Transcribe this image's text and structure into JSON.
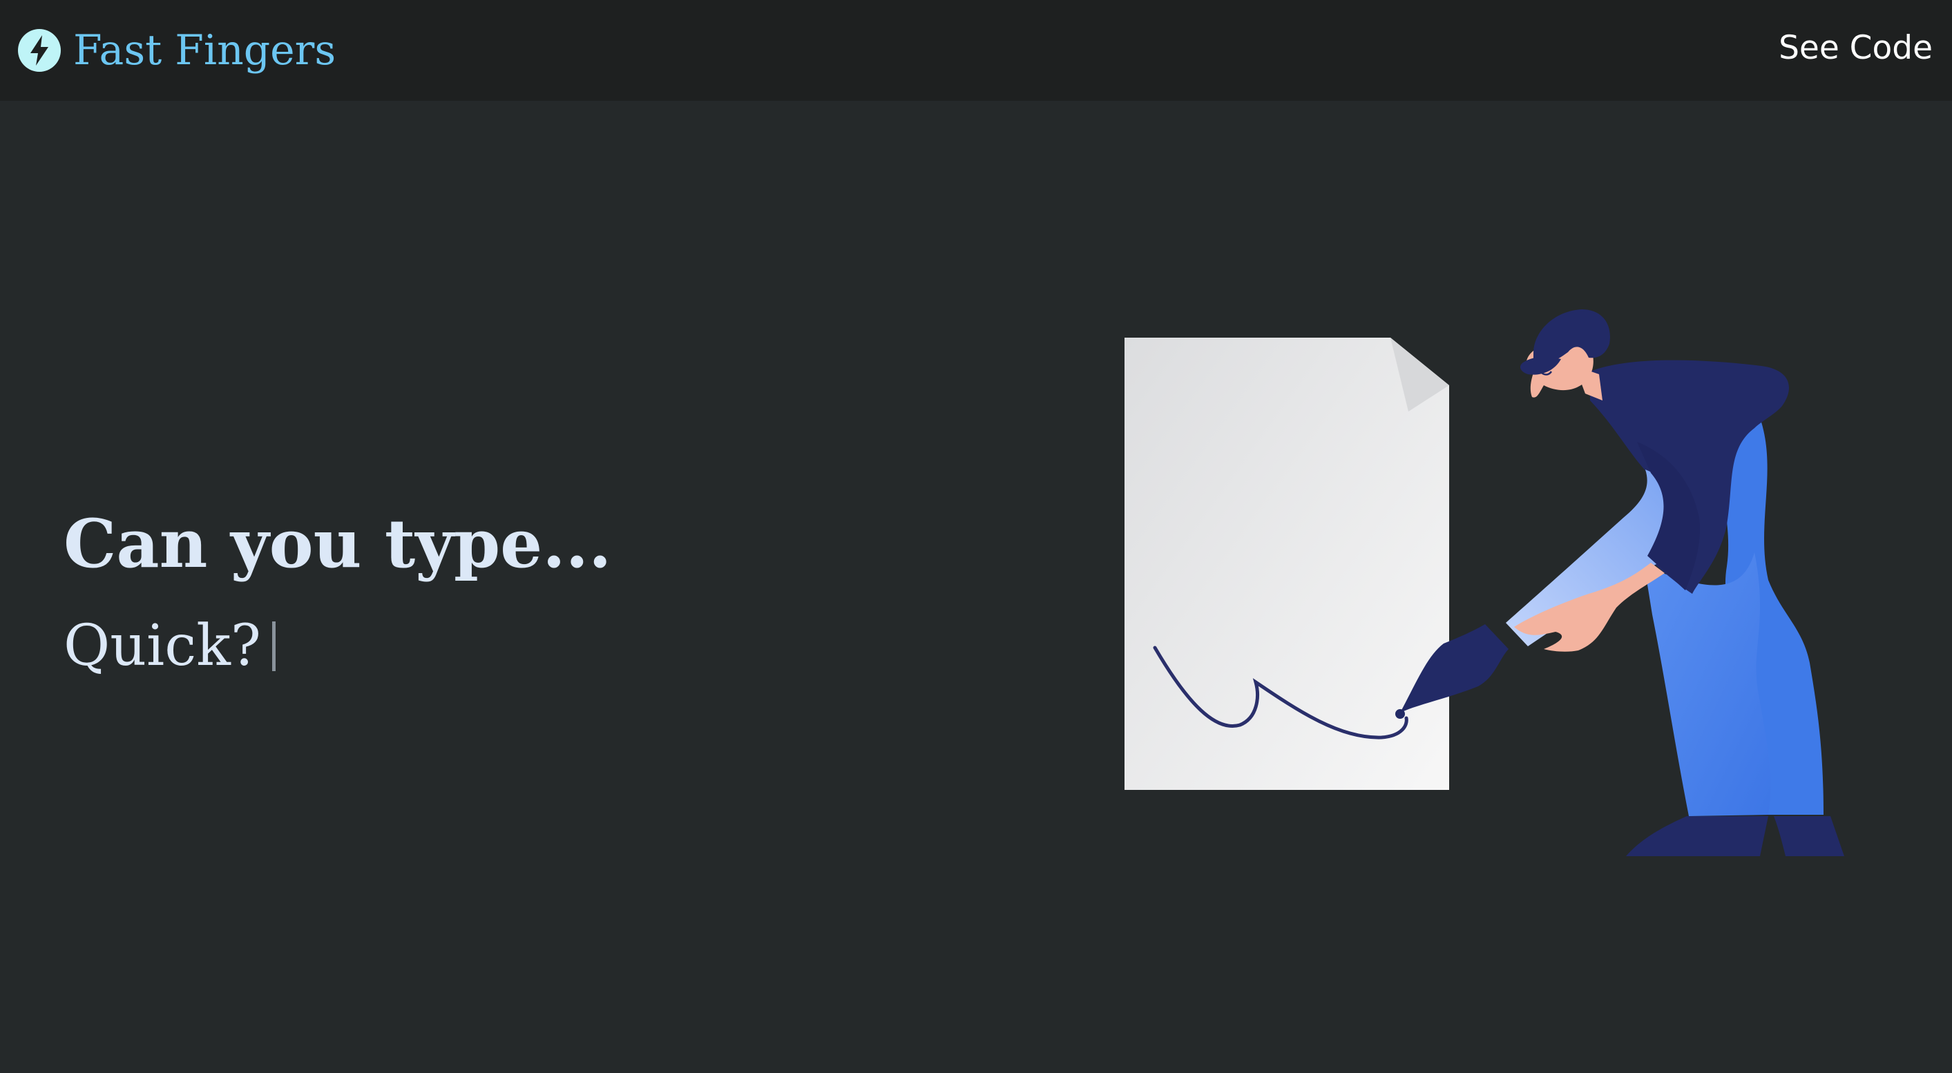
{
  "navbar": {
    "brand_name": "Fast Fingers",
    "brand_icon": "lightning-bolt-icon",
    "see_code_label": "See Code"
  },
  "hero": {
    "title": "Can you type...",
    "typed_text": "Quick?"
  },
  "illustration": {
    "description_icon": "person-signing-document-illustration"
  },
  "colors": {
    "page_background": "#25292a",
    "navbar_background": "#1e2020",
    "brand_color": "#6cc6f2",
    "hero_text": "#dce8f7",
    "figure_navy": "#222a66",
    "figure_blue": "#4a84ea"
  }
}
